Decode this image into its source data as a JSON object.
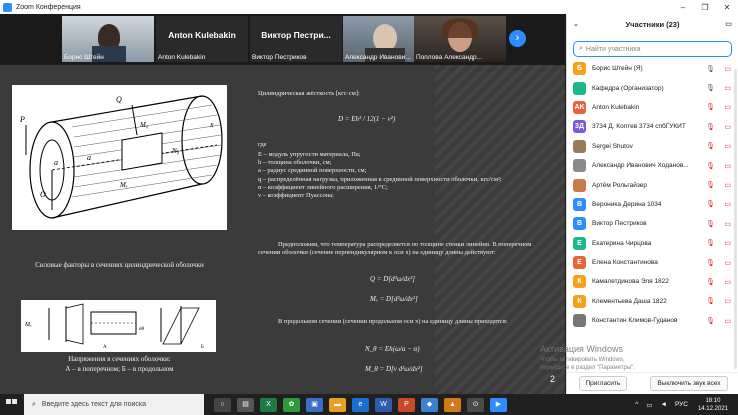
{
  "window": {
    "title": "Zoom Конференция",
    "controls": [
      "–",
      "❐",
      "✕"
    ]
  },
  "thumbnails": [
    {
      "name": "Борис Штейн",
      "big": ""
    },
    {
      "name": "Anton Kulebakin",
      "big": "Anton Kulebakin"
    },
    {
      "name": "Виктор Пестриков",
      "big": "Виктор  Пестри..."
    },
    {
      "name": "Александр Иванови...",
      "big": ""
    },
    {
      "name": "Поплова Александр...",
      "big": ""
    }
  ],
  "slide": {
    "title": "Цилиндрическая жёсткость [кгс·см]:",
    "formula_D": "D = Eh³ / 12(1 − ν²)",
    "where": "где",
    "defs": [
      "E – модуль упругости материала, Па;",
      "h – толщина оболочки, см;",
      "a – радиус срединной поверхности, см;",
      "q – распределённая нагрузка, приложенная к срединной поверхности оболочки, кгс/см²;",
      "α – коэффициент линейного расширения, 1/°C;",
      "ν – коэффициент Пуассона;"
    ],
    "para1": "Предположим, что температура распределяется по толщине стенки линейно. В поперечном сечении оболочки (сечение перпендикулярном к оси x) на единицу длины действуют:",
    "formula_Q": "Q = D[d³ω/dx³]",
    "formula_Mx": "Mₓ = D[d²ω/dx²]",
    "para2": "В продольном сечении (сечении продольном оси x) на единицу длины приходятся:",
    "formula_N": "N_θ = Eh(ω/a − α)",
    "formula_M": "M_θ = D[ν d²ω/dx²]",
    "caption1": "Силовые факторы в сечениях цилиндрической оболочки",
    "caption2a": "Напряжения в сечениях оболочки:",
    "caption2b": "А – в поперечном; Б – в продольном",
    "page": "2"
  },
  "participants": {
    "header": "Участники (23)",
    "search_placeholder": "Найти участника",
    "list": [
      {
        "initial": "Б",
        "color": "#f7a11a",
        "name": "Борис Штейн (Я)",
        "mic_on": true
      },
      {
        "initial": "",
        "color": "#1fb58f",
        "name": "Кафедра (Организатор)",
        "mic_on": true
      },
      {
        "initial": "AK",
        "color": "#e8623a",
        "name": "Anton Kulebakin",
        "mic_on": false
      },
      {
        "initial": "3Д",
        "color": "#7a5ad9",
        "name": "3734 Д. Коптев 3734 спбГУКИТ",
        "mic_on": false
      },
      {
        "initial": "",
        "color": "#9b7a5a",
        "name": "Sergei Shutov",
        "mic_on": false
      },
      {
        "initial": "",
        "color": "#8a8a8a",
        "name": "Александр Иванович Ходанов...",
        "mic_on": false
      },
      {
        "initial": "",
        "color": "#c97a4a",
        "name": "Артём Рольгайзер",
        "mic_on": false
      },
      {
        "initial": "В",
        "color": "#2d8cff",
        "name": "Вероника Дерина 1034",
        "mic_on": false
      },
      {
        "initial": "В",
        "color": "#2d8cff",
        "name": "Виктор Пестриков",
        "mic_on": false
      },
      {
        "initial": "Е",
        "color": "#1fb58f",
        "name": "Екатерина Чирцова",
        "mic_on": false
      },
      {
        "initial": "Е",
        "color": "#e8623a",
        "name": "Елена Константинова",
        "mic_on": false
      },
      {
        "initial": "К",
        "color": "#f7a11a",
        "name": "Камалетдинова Эля 1822",
        "mic_on": false
      },
      {
        "initial": "К",
        "color": "#f7a11a",
        "name": "Клементьева Даша 1822",
        "mic_on": false
      },
      {
        "initial": "",
        "color": "#777",
        "name": "Константин Климов-Гуданов",
        "mic_on": false
      }
    ],
    "invite": "Пригласить",
    "mute_all": "Выключить звук всех"
  },
  "activation": {
    "line1": "Активация Windows",
    "line2": "Чтобы активировать Windows, перейдите в раздел \"Параметры\"."
  },
  "taskbar": {
    "search_text": "Введите здесь текст для поиска",
    "lang": "РУС",
    "time": "18:10",
    "date": "14.12.2021"
  }
}
